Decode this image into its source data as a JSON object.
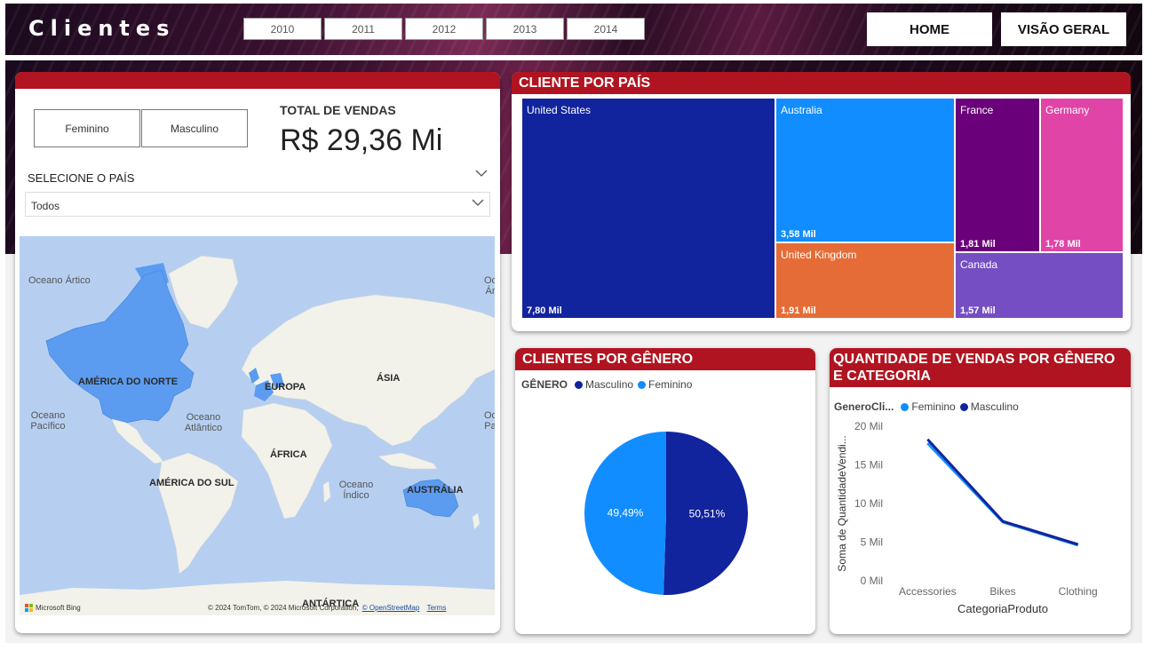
{
  "header": {
    "title": "Clientes",
    "years": [
      "2010",
      "2011",
      "2012",
      "2013",
      "2014"
    ],
    "nav": {
      "home": "HOME",
      "visao_geral": "VISÃO GERAL"
    }
  },
  "filters": {
    "gender_buttons": [
      "Feminino",
      "Masculino"
    ],
    "country_label": "SELECIONE O PAÍS",
    "country_value": "Todos"
  },
  "kpi": {
    "label": "TOTAL DE VENDAS",
    "value": "R$ 29,36 Mi"
  },
  "map": {
    "labels": {
      "ocean_arctic_left": "Oceano Ártico",
      "ocean_arctic_right": "Oc Ár",
      "north_america": "AMÉRICA DO NORTE",
      "europe": "EUROPA",
      "asia": "ÁSIA",
      "ocean_pacific": "Oceano Pacífico",
      "ocean_pacific_right": "Oc Pa",
      "ocean_atlantic": "Oceano Atlântico",
      "africa": "ÁFRICA",
      "south_america": "AMÉRICA DO SUL",
      "ocean_indian": "Oceano Índico",
      "australia": "AUSTRÁLIA",
      "antarctica": "ANTÁRTICA"
    },
    "brand": "Microsoft Bing",
    "copyright": "© 2024 TomTom, © 2024 Microsoft Corporation,",
    "osm_link": "© OpenStreetMap",
    "terms_link": "Terms",
    "highlight_color": "#5b9cf0"
  },
  "treemap": {
    "title": "CLIENTE POR PAÍS",
    "tiles": [
      {
        "name": "United States",
        "value": "7,80 Mil",
        "color": "#12239e"
      },
      {
        "name": "Australia",
        "value": "3,58 Mil",
        "color": "#118dff"
      },
      {
        "name": "United Kingdom",
        "value": "1,91 Mil",
        "color": "#e66c37"
      },
      {
        "name": "France",
        "value": "1,81 Mil",
        "color": "#6b007b"
      },
      {
        "name": "Germany",
        "value": "1,78 Mil",
        "color": "#e044a7"
      },
      {
        "name": "Canada",
        "value": "1,57 Mil",
        "color": "#744ec2"
      }
    ]
  },
  "pie": {
    "title": "CLIENTES POR GÊNERO",
    "legend_title": "GÊNERO",
    "legend": [
      {
        "name": "Masculino",
        "color": "#12239e"
      },
      {
        "name": "Feminino",
        "color": "#118dff"
      }
    ]
  },
  "line_chart_meta": {
    "title": "QUANTIDADE DE VENDAS POR GÊNERO E CATEGORIA",
    "legend_title": "GeneroCli...",
    "y_tick_labels": [
      "20 Mil",
      "15 Mil",
      "10 Mil",
      "5 Mil",
      "0 Mil"
    ]
  },
  "chart_data": [
    {
      "type": "pie",
      "categories": [
        "Masculino",
        "Feminino"
      ],
      "values": [
        50.51,
        49.49
      ],
      "labels": [
        "50,51%",
        "49,49%"
      ],
      "colors": [
        "#12239e",
        "#118dff"
      ]
    },
    {
      "type": "line",
      "x": [
        "Accessories",
        "Bikes",
        "Clothing"
      ],
      "series": [
        {
          "name": "Feminino",
          "values": [
            17800,
            7600,
            4600
          ],
          "color": "#118dff"
        },
        {
          "name": "Masculino",
          "values": [
            18300,
            7700,
            4700
          ],
          "color": "#12239e"
        }
      ],
      "xlabel": "CategoriaProduto",
      "ylabel": "Soma de QuantidadeVendi...",
      "ylim": [
        0,
        20000
      ],
      "grid": false,
      "legend": "top"
    }
  ]
}
